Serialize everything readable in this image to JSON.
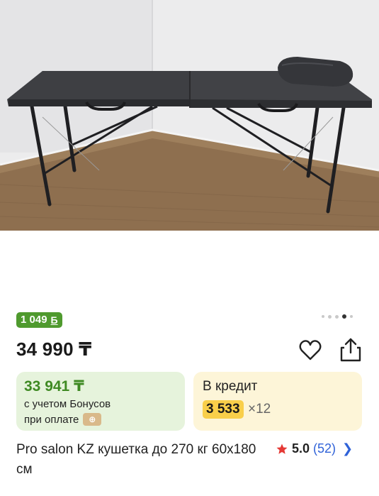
{
  "bonus_badge": {
    "amount": "1 049",
    "icon": "bonus-b-icon"
  },
  "gallery": {
    "dots_count": 5,
    "active_index": 3
  },
  "price": {
    "main": "34 990 ₸"
  },
  "actions": {
    "favorite_icon": "heart-icon",
    "share_icon": "share-icon"
  },
  "bonus_offer": {
    "amount": "33 941 ₸",
    "line1": "с учетом Бонусов",
    "line2": "при оплате",
    "pay_icon": "payment-icon"
  },
  "credit": {
    "title": "В кредит",
    "monthly": "3 533",
    "months": "×12"
  },
  "product": {
    "title": "Pro salon KZ кушетка до 270 кг 60х180 см"
  },
  "rating": {
    "score": "5.0",
    "count": "(52)",
    "stars": 5.0
  },
  "colors": {
    "bonus_green": "#4f9a2e",
    "bonus_card_bg": "#e6f3dc",
    "credit_card_bg": "#fdf5d8",
    "credit_highlight": "#f9cf4a",
    "link_blue": "#2f62d8",
    "star_red": "#e53935"
  }
}
